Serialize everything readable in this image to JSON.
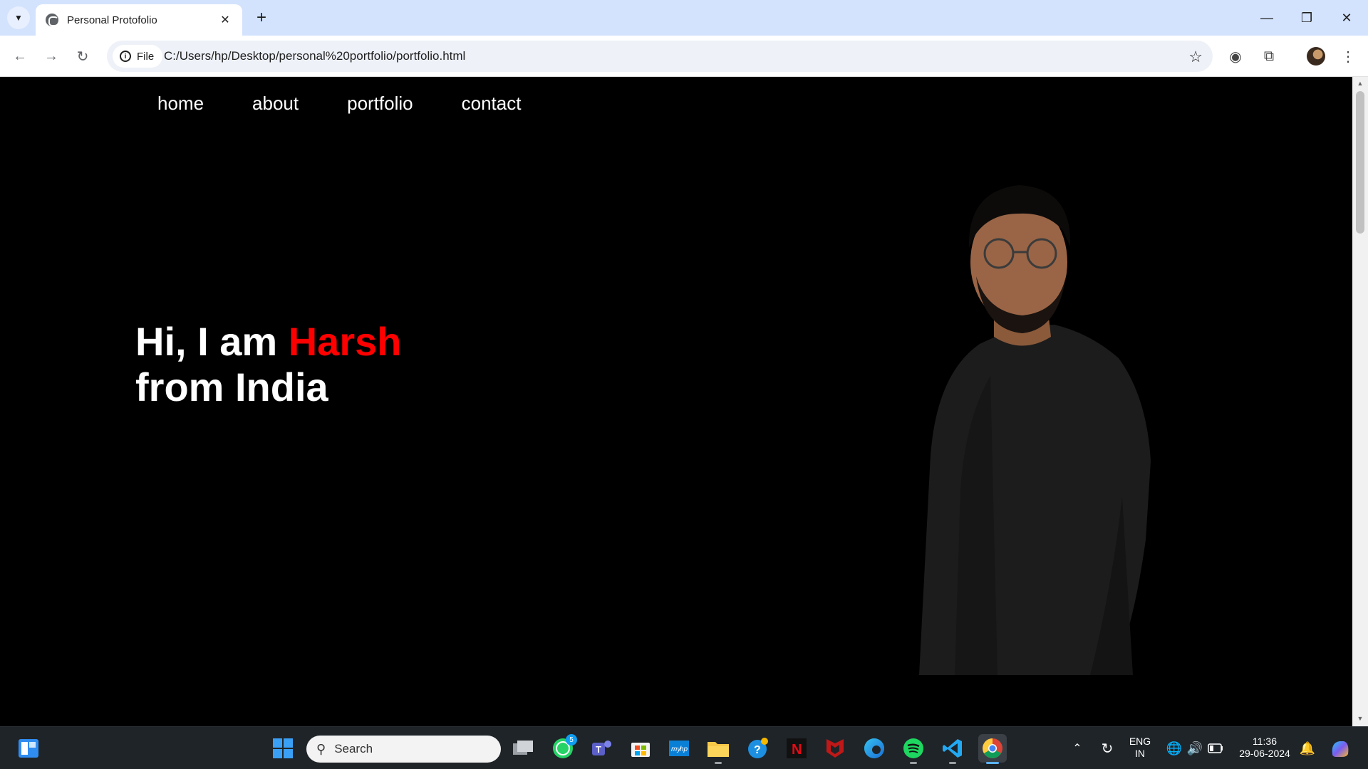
{
  "browser": {
    "tab_title": "Personal Protofolio",
    "url_chip": "File",
    "url": "C:/Users/hp/Desktop/personal%20portfolio/portfolio.html"
  },
  "site": {
    "nav": [
      {
        "label": "home"
      },
      {
        "label": "about"
      },
      {
        "label": "portfolio"
      },
      {
        "label": "contact"
      }
    ],
    "hero": {
      "prefix": "Hi, I am ",
      "name": "Harsh",
      "suffix": "from India",
      "accent_color": "#ff0000"
    }
  },
  "taskbar": {
    "search_placeholder": "Search",
    "whatsapp_badge": "5",
    "lang_top": "ENG",
    "lang_bottom": "IN",
    "time": "11:36",
    "date": "29-06-2024"
  }
}
